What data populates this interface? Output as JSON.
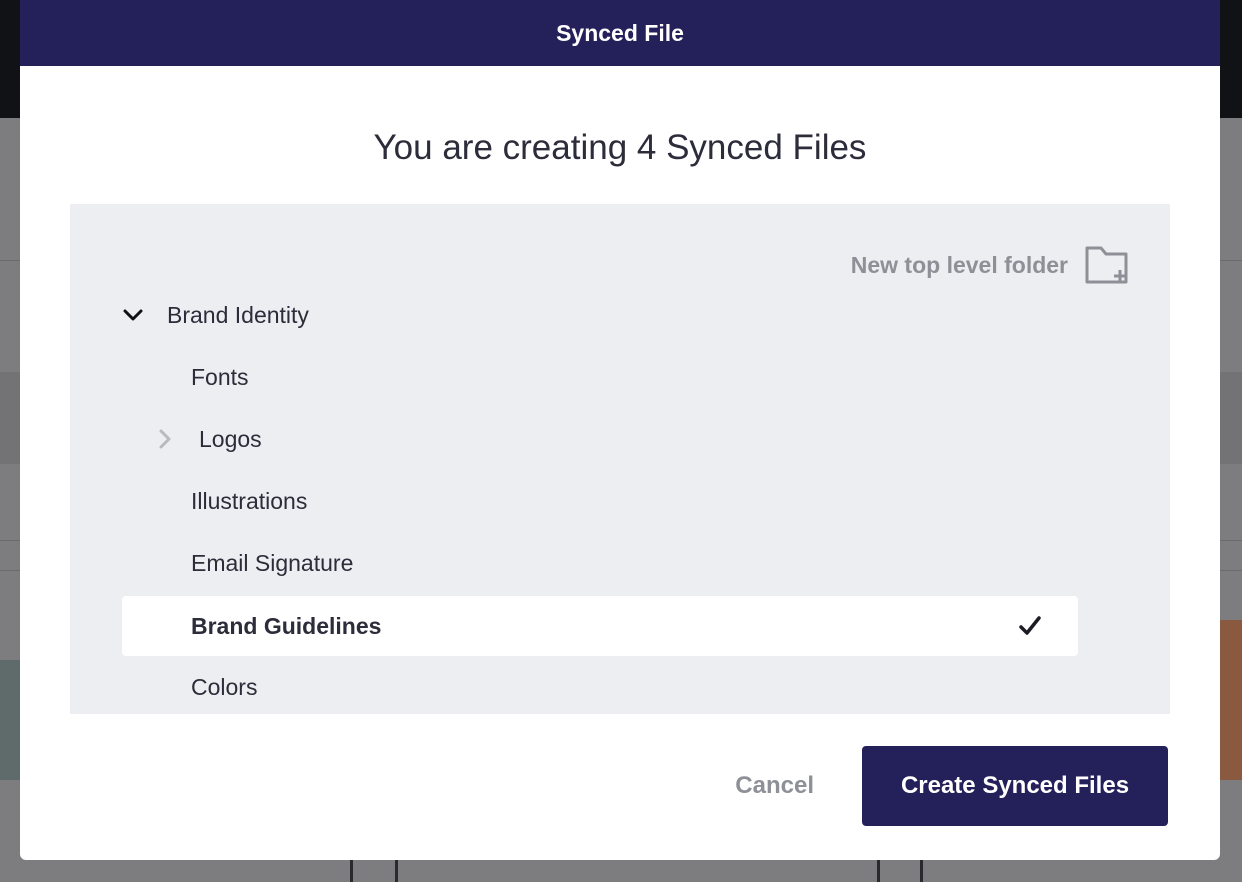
{
  "modal": {
    "title": "Synced File",
    "heading": "You are creating 4 Synced Files"
  },
  "folder_panel": {
    "new_folder_label": "New top level folder",
    "items": [
      {
        "label": "Brand Identity",
        "expanded": true,
        "level": 0
      },
      {
        "label": "Fonts",
        "level": 1
      },
      {
        "label": "Logos",
        "level": 1,
        "expanded": false
      },
      {
        "label": "Illustrations",
        "level": 1
      },
      {
        "label": "Email Signature",
        "level": 1
      },
      {
        "label": "Brand Guidelines",
        "level": 1,
        "selected": true
      },
      {
        "label": "Colors",
        "level": 1
      }
    ]
  },
  "actions": {
    "cancel_label": "Cancel",
    "create_label": "Create Synced Files"
  },
  "colors": {
    "header_bg": "#24215a",
    "primary_button": "#24215a",
    "panel_bg": "#edeef1",
    "muted_text": "#8e9097"
  },
  "icons": {
    "new_folder": "folder-plus-icon",
    "expanded": "chevron-down-icon",
    "collapsed": "chevron-right-icon",
    "selected": "checkmark-icon"
  }
}
